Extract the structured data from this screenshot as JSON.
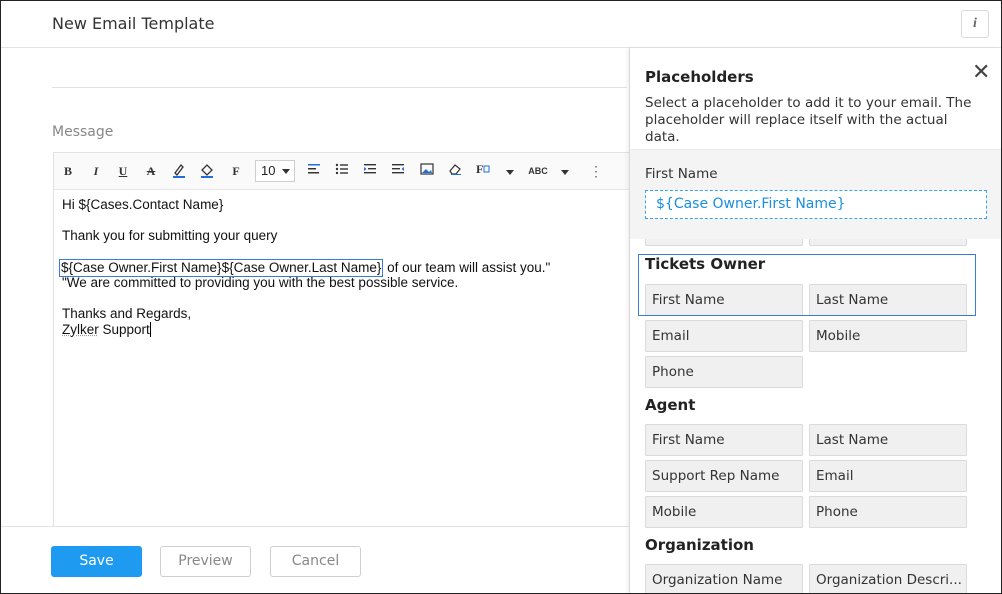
{
  "header": {
    "title": "New Email Template",
    "info_icon": "i"
  },
  "editor": {
    "message_label": "Message",
    "toolbar": {
      "bold": "B",
      "italic": "I",
      "underline": "U",
      "strike": "A",
      "font": "F",
      "font_size": "10",
      "spell": "ABC"
    },
    "lines": {
      "greeting": "Hi ${Cases.Contact Name}",
      "thanks": "Thank you for submitting your query",
      "placeholder_insert": "${Case Owner.First Name}${Case Owner.Last Name}",
      "assist": " of our team will assist you.\"",
      "commit": "\"We are committed to providing you with the best possible service.",
      "regards": "Thanks and Regards,",
      "sig_a": "Zylker",
      "sig_b": " Support"
    }
  },
  "footer": {
    "save": "Save",
    "preview": "Preview",
    "cancel": "Cancel"
  },
  "panel": {
    "title": "Placeholders",
    "description": "Select a placeholder to add it to your email. The placeholder will replace itself with the actual data.",
    "selected_label": "First Name",
    "selected_value": "${Case Owner.First Name}",
    "groups": {
      "tickets_owner": {
        "title": "Tickets Owner",
        "items": [
          "First Name",
          "Last Name",
          "Email",
          "Mobile",
          "Phone"
        ]
      },
      "agent": {
        "title": "Agent",
        "items": [
          "First Name",
          "Last Name",
          "Support Rep Name",
          "Email",
          "Mobile",
          "Phone"
        ]
      },
      "organization": {
        "title": "Organization",
        "items": [
          "Organization Name",
          "Organization Descri..."
        ]
      }
    }
  },
  "colors": {
    "accent": "#1e9bf0",
    "highlight_border": "#3a7bd5",
    "placeholder_text": "#1a8fe0"
  }
}
